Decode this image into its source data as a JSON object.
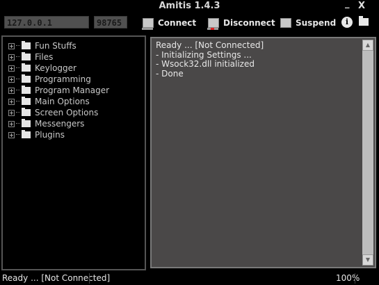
{
  "window": {
    "title": "Amitis 1.4.3",
    "minimize_label": "_",
    "close_label": "X"
  },
  "toolbar": {
    "ip_value": "127.0.0.1",
    "port_value": "98765",
    "connect_label": "Connect",
    "disconnect_label": "Disconnect",
    "suspend_label": "Suspend",
    "info_icon": "i",
    "folder_icon": "folder-icon"
  },
  "tree": {
    "items": [
      {
        "label": "Fun Stuffs"
      },
      {
        "label": "Files"
      },
      {
        "label": "Keylogger"
      },
      {
        "label": "Programming"
      },
      {
        "label": "Program Manager"
      },
      {
        "label": "Main Options"
      },
      {
        "label": "Screen Options"
      },
      {
        "label": "Messengers"
      },
      {
        "label": "Plugins"
      }
    ]
  },
  "log": {
    "lines": [
      "Ready ... [Not Connected]",
      "- Initializing Settings ...",
      "- Wsock32.dll initialized",
      "- Done"
    ]
  },
  "statusbar": {
    "status": "Ready ... [Not Connected]",
    "percent": "100%"
  }
}
